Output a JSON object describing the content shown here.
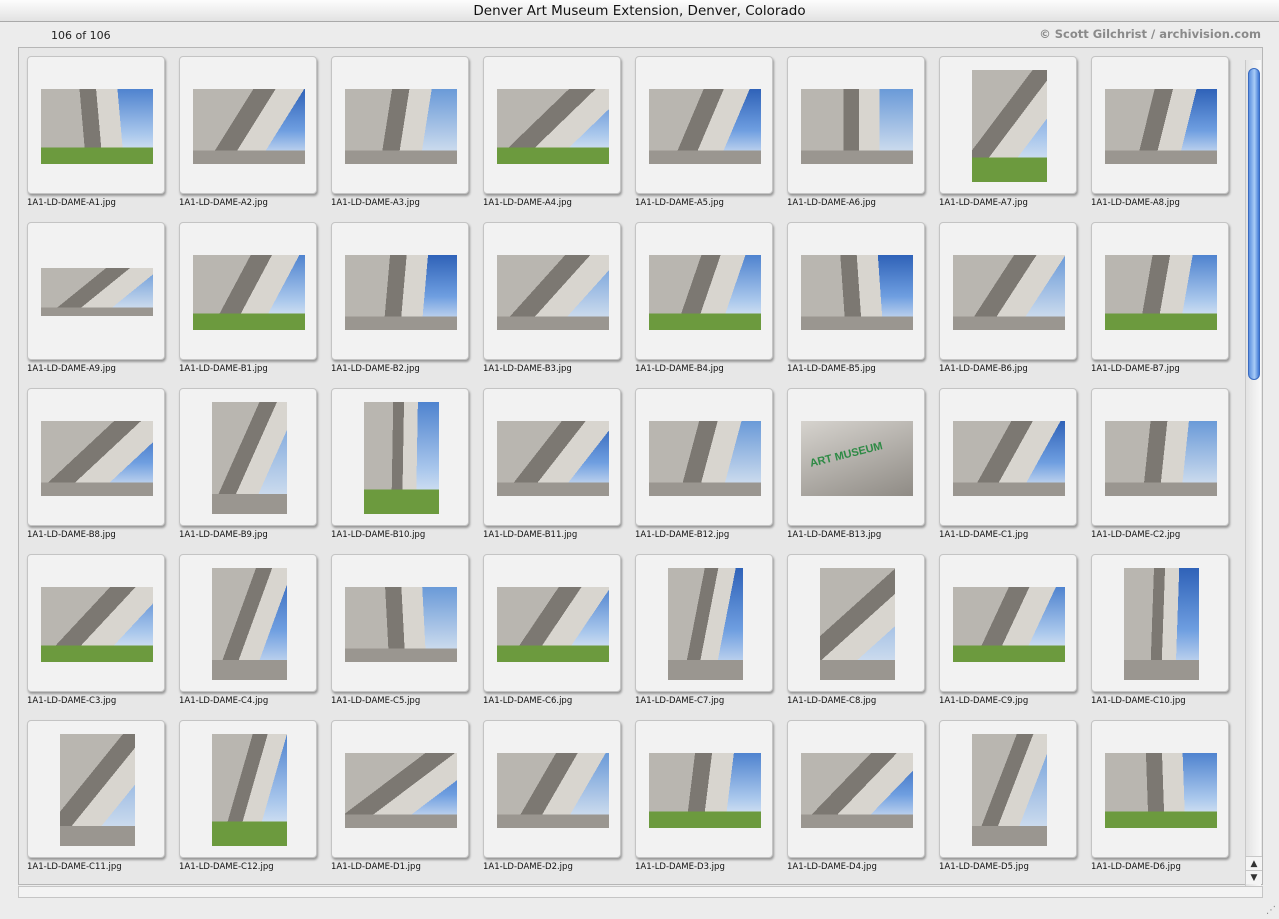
{
  "window": {
    "title": "Denver Art Museum Extension, Denver, Colorado"
  },
  "infobar": {
    "count": "106 of 106",
    "credit": "© Scott Gilchrist / archivision.com"
  },
  "thumbnails": [
    {
      "file": "1A1-LD-DAME-A1.jpg",
      "orient": "land"
    },
    {
      "file": "1A1-LD-DAME-A2.jpg",
      "orient": "land"
    },
    {
      "file": "1A1-LD-DAME-A3.jpg",
      "orient": "land"
    },
    {
      "file": "1A1-LD-DAME-A4.jpg",
      "orient": "land"
    },
    {
      "file": "1A1-LD-DAME-A5.jpg",
      "orient": "land"
    },
    {
      "file": "1A1-LD-DAME-A6.jpg",
      "orient": "land"
    },
    {
      "file": "1A1-LD-DAME-A7.jpg",
      "orient": "port"
    },
    {
      "file": "1A1-LD-DAME-A8.jpg",
      "orient": "land"
    },
    {
      "file": "1A1-LD-DAME-A9.jpg",
      "orient": "pano"
    },
    {
      "file": "1A1-LD-DAME-B1.jpg",
      "orient": "land"
    },
    {
      "file": "1A1-LD-DAME-B2.jpg",
      "orient": "land"
    },
    {
      "file": "1A1-LD-DAME-B3.jpg",
      "orient": "land"
    },
    {
      "file": "1A1-LD-DAME-B4.jpg",
      "orient": "land"
    },
    {
      "file": "1A1-LD-DAME-B5.jpg",
      "orient": "land"
    },
    {
      "file": "1A1-LD-DAME-B6.jpg",
      "orient": "land"
    },
    {
      "file": "1A1-LD-DAME-B7.jpg",
      "orient": "land"
    },
    {
      "file": "1A1-LD-DAME-B8.jpg",
      "orient": "land"
    },
    {
      "file": "1A1-LD-DAME-B9.jpg",
      "orient": "port"
    },
    {
      "file": "1A1-LD-DAME-B10.jpg",
      "orient": "port"
    },
    {
      "file": "1A1-LD-DAME-B11.jpg",
      "orient": "land"
    },
    {
      "file": "1A1-LD-DAME-B12.jpg",
      "orient": "land"
    },
    {
      "file": "1A1-LD-DAME-B13.jpg",
      "orient": "land",
      "sign": "ART MUSEUM"
    },
    {
      "file": "1A1-LD-DAME-C1.jpg",
      "orient": "land"
    },
    {
      "file": "1A1-LD-DAME-C2.jpg",
      "orient": "land"
    },
    {
      "file": "1A1-LD-DAME-C3.jpg",
      "orient": "land"
    },
    {
      "file": "1A1-LD-DAME-C4.jpg",
      "orient": "port"
    },
    {
      "file": "1A1-LD-DAME-C5.jpg",
      "orient": "land"
    },
    {
      "file": "1A1-LD-DAME-C6.jpg",
      "orient": "land"
    },
    {
      "file": "1A1-LD-DAME-C7.jpg",
      "orient": "port"
    },
    {
      "file": "1A1-LD-DAME-C8.jpg",
      "orient": "port"
    },
    {
      "file": "1A1-LD-DAME-C9.jpg",
      "orient": "land"
    },
    {
      "file": "1A1-LD-DAME-C10.jpg",
      "orient": "port"
    },
    {
      "file": "1A1-LD-DAME-C11.jpg",
      "orient": "port"
    },
    {
      "file": "1A1-LD-DAME-C12.jpg",
      "orient": "port"
    },
    {
      "file": "1A1-LD-DAME-D1.jpg",
      "orient": "land"
    },
    {
      "file": "1A1-LD-DAME-D2.jpg",
      "orient": "land"
    },
    {
      "file": "1A1-LD-DAME-D3.jpg",
      "orient": "land"
    },
    {
      "file": "1A1-LD-DAME-D4.jpg",
      "orient": "land"
    },
    {
      "file": "1A1-LD-DAME-D5.jpg",
      "orient": "port"
    },
    {
      "file": "1A1-LD-DAME-D6.jpg",
      "orient": "land"
    }
  ],
  "colors": {
    "sky": "#6a9ad8",
    "cloud": "#eef2f6",
    "titanium": "#b9b6b0",
    "titanium_dark": "#7c7872",
    "grass": "#6c9a3e",
    "pavement": "#9a9690",
    "glass": "#5a9ea6",
    "sign": "#2e8a45"
  },
  "scrollbar": {
    "up": "▲",
    "down": "▼",
    "resize": "⋰"
  }
}
